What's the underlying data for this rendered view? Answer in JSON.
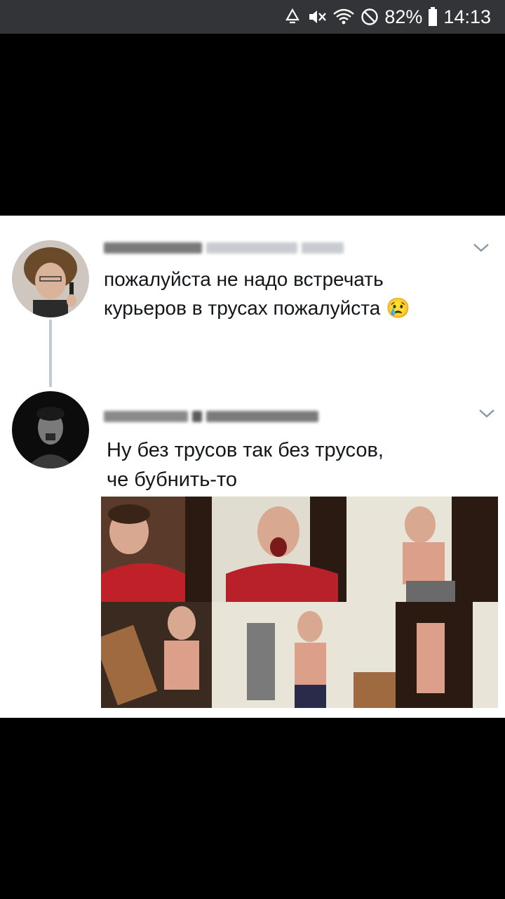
{
  "status_bar": {
    "battery_percent": "82%",
    "time": "14:13",
    "icons": [
      "recycle-icon",
      "mute-icon",
      "wifi-icon",
      "no-disturb-icon",
      "battery-icon"
    ]
  },
  "tweets": [
    {
      "text_line1": "пожалуйста не надо встречать",
      "text_line2": "курьеров в трусах пожалуйста",
      "emoji": "😢"
    },
    {
      "text_line1": "Ну без трусов так без трусов,",
      "text_line2": "че бубнить-то"
    }
  ],
  "colors": {
    "status_bar_bg": "#333437",
    "text": "#14171a",
    "thread_line": "#c4ccd2",
    "chevron": "#8899a6"
  }
}
